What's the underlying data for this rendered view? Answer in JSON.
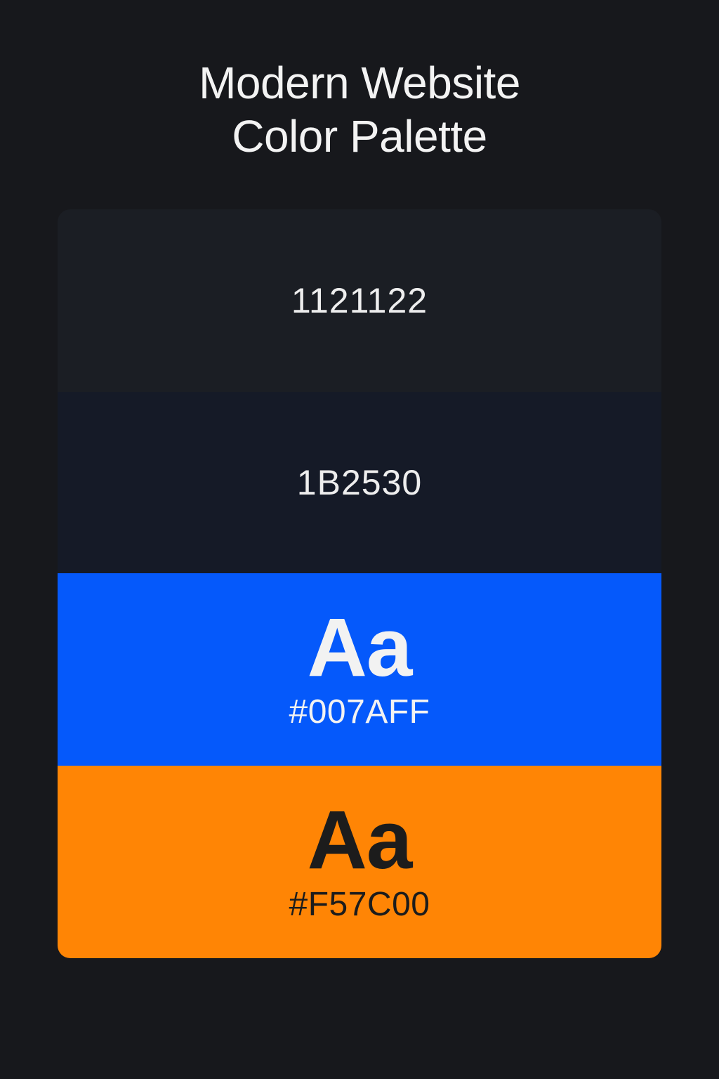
{
  "title": {
    "line1": "Modern Website",
    "line2": "Color Palette"
  },
  "swatches": [
    {
      "label": "1121122",
      "color": "#1b1e24"
    },
    {
      "label": "1B2530",
      "color": "#151a27"
    },
    {
      "sample": "Aa",
      "hex": "#007AFF",
      "color": "#0559fb",
      "text_color": "#f2f2f2"
    },
    {
      "sample": "Aa",
      "hex": "#F57C00",
      "color": "#ff8505",
      "text_color": "#1c1c1c"
    }
  ],
  "colors": {
    "background": "#17181c"
  }
}
